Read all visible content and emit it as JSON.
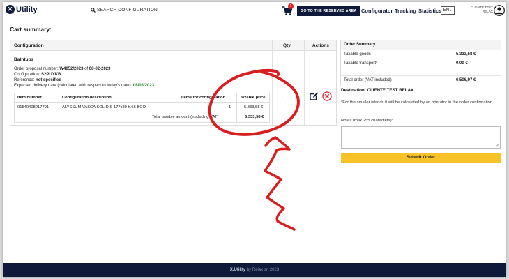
{
  "header": {
    "logo_text": "Utility",
    "search_label": "SEARCH CONFIGURATION",
    "cart_count": "1",
    "reserved_area_label": "GO TO THE RESERVED AREA",
    "nav": [
      "Configurator",
      "Tracking",
      "Statistics"
    ],
    "lang": "EN",
    "user_line1": "CLIENTE TEST",
    "user_line2": "RELAX"
  },
  "page": {
    "title": "Cart summary:"
  },
  "cart": {
    "headers": {
      "configuration": "Configuration",
      "qty": "Qty",
      "actions": "Actions"
    },
    "group": "Bathtubs",
    "order_proposal_label": "Order proposal number:",
    "order_proposal_number": "W4052/2023",
    "order_of": "of",
    "order_date": "08-02-2023",
    "configuration_label": "Configuration:",
    "configuration_value": "S2PUYKB",
    "reference_label": "Reference:",
    "reference_value": "not specified",
    "delivery_label": "Expected delivery date (calculated with respect to today's date):",
    "delivery_value": "06/03/2023",
    "qty": "1",
    "items_table": {
      "headers": [
        "Item number",
        "Configuration description",
        "Items for configuration",
        "taxable price"
      ],
      "rows": [
        [
          "01540408017701",
          "ALYSSUM VASCA SOLID.S 177x80 h.56 BCO",
          "1",
          "5.333,58 €"
        ]
      ],
      "total_label": "Total taxable amount (excluding VAT)",
      "total_value": "5.333,58 €"
    }
  },
  "summary": {
    "title": "Order Summary",
    "taxable_goods_label": "Taxable goods",
    "taxable_goods_value": "5.333,58 €",
    "taxable_transport_label": "Taxable transport*",
    "taxable_transport_value": "0,00 €",
    "total_label": "Total order (VAT included)",
    "total_value": "6.506,97 €",
    "destination": "Destination: CLIENTE TEST RELAX",
    "note": "*For the smaller islands it will be calculated by an operator in the order confirmation.",
    "notes_label": "Notes (max 255 characters):",
    "notes_value": "",
    "submit_label": "Submit Order"
  },
  "footer": {
    "brand": "X.Utility",
    "by": "by Relax srl 2023"
  },
  "colors": {
    "navy": "#0f1a3a",
    "accent_yellow": "#f7c326",
    "delete_red": "#e02020",
    "annotation_red": "#d81e1e",
    "delivery_green": "#1a8a1a"
  }
}
